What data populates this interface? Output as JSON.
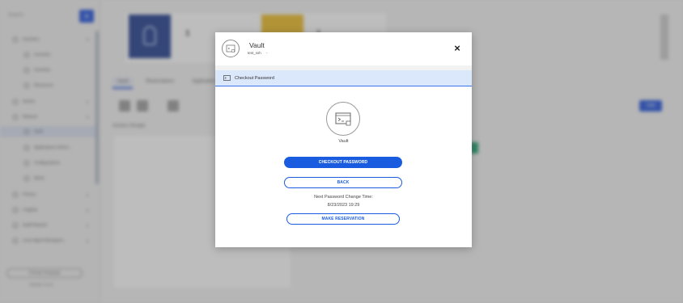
{
  "sidebar": {
    "search_placeholder": "Search",
    "items": [
      {
        "label": "Inventory",
        "top": 0
      },
      {
        "label": "Inventory"
      },
      {
        "label": "Inventory"
      },
      {
        "label": "Resources"
      },
      {
        "label": "Assets"
      },
      {
        "label": "Network"
      },
      {
        "label": "Vault"
      },
      {
        "label": "Applications Inform..."
      },
      {
        "label": "Configurations"
      },
      {
        "label": "Alerts"
      },
      {
        "label": "Privacy"
      },
      {
        "label": "Logging"
      },
      {
        "label": "Audit Reports"
      },
      {
        "label": "Linux Agent Managem..."
      }
    ],
    "language": "Change language",
    "version": "Version 2.0.0"
  },
  "main": {
    "stat_number_1": "1",
    "stat_number_2": "1",
    "tabs": [
      "Vault",
      "Reservations",
      "Application"
    ],
    "add_label": "Add",
    "access_groups": "Access Groups"
  },
  "modal": {
    "title": "Vault",
    "subtitle": "test_ssh",
    "subtitle_extra": "-",
    "close_label": "×",
    "section_title": "Checkout Password",
    "vault_name": "Vault",
    "checkout_button": "CHECKOUT PASSWORD",
    "back_button": "BACK",
    "next_change_label": "Next Password Change Time:",
    "next_change_time": "8/23/2023 19:29",
    "reservation_button": "MAKE RESERVATION"
  },
  "colors": {
    "accent": "#1a5ce0",
    "section_bar": "#dbe7fb",
    "sidebar_plus": "#1d4ed8"
  },
  "icons": {
    "modal_avatar": "vault-terminal-icon",
    "section_bar": "terminal-card-icon",
    "big_icon": "terminal-icon",
    "close": "close-icon"
  }
}
